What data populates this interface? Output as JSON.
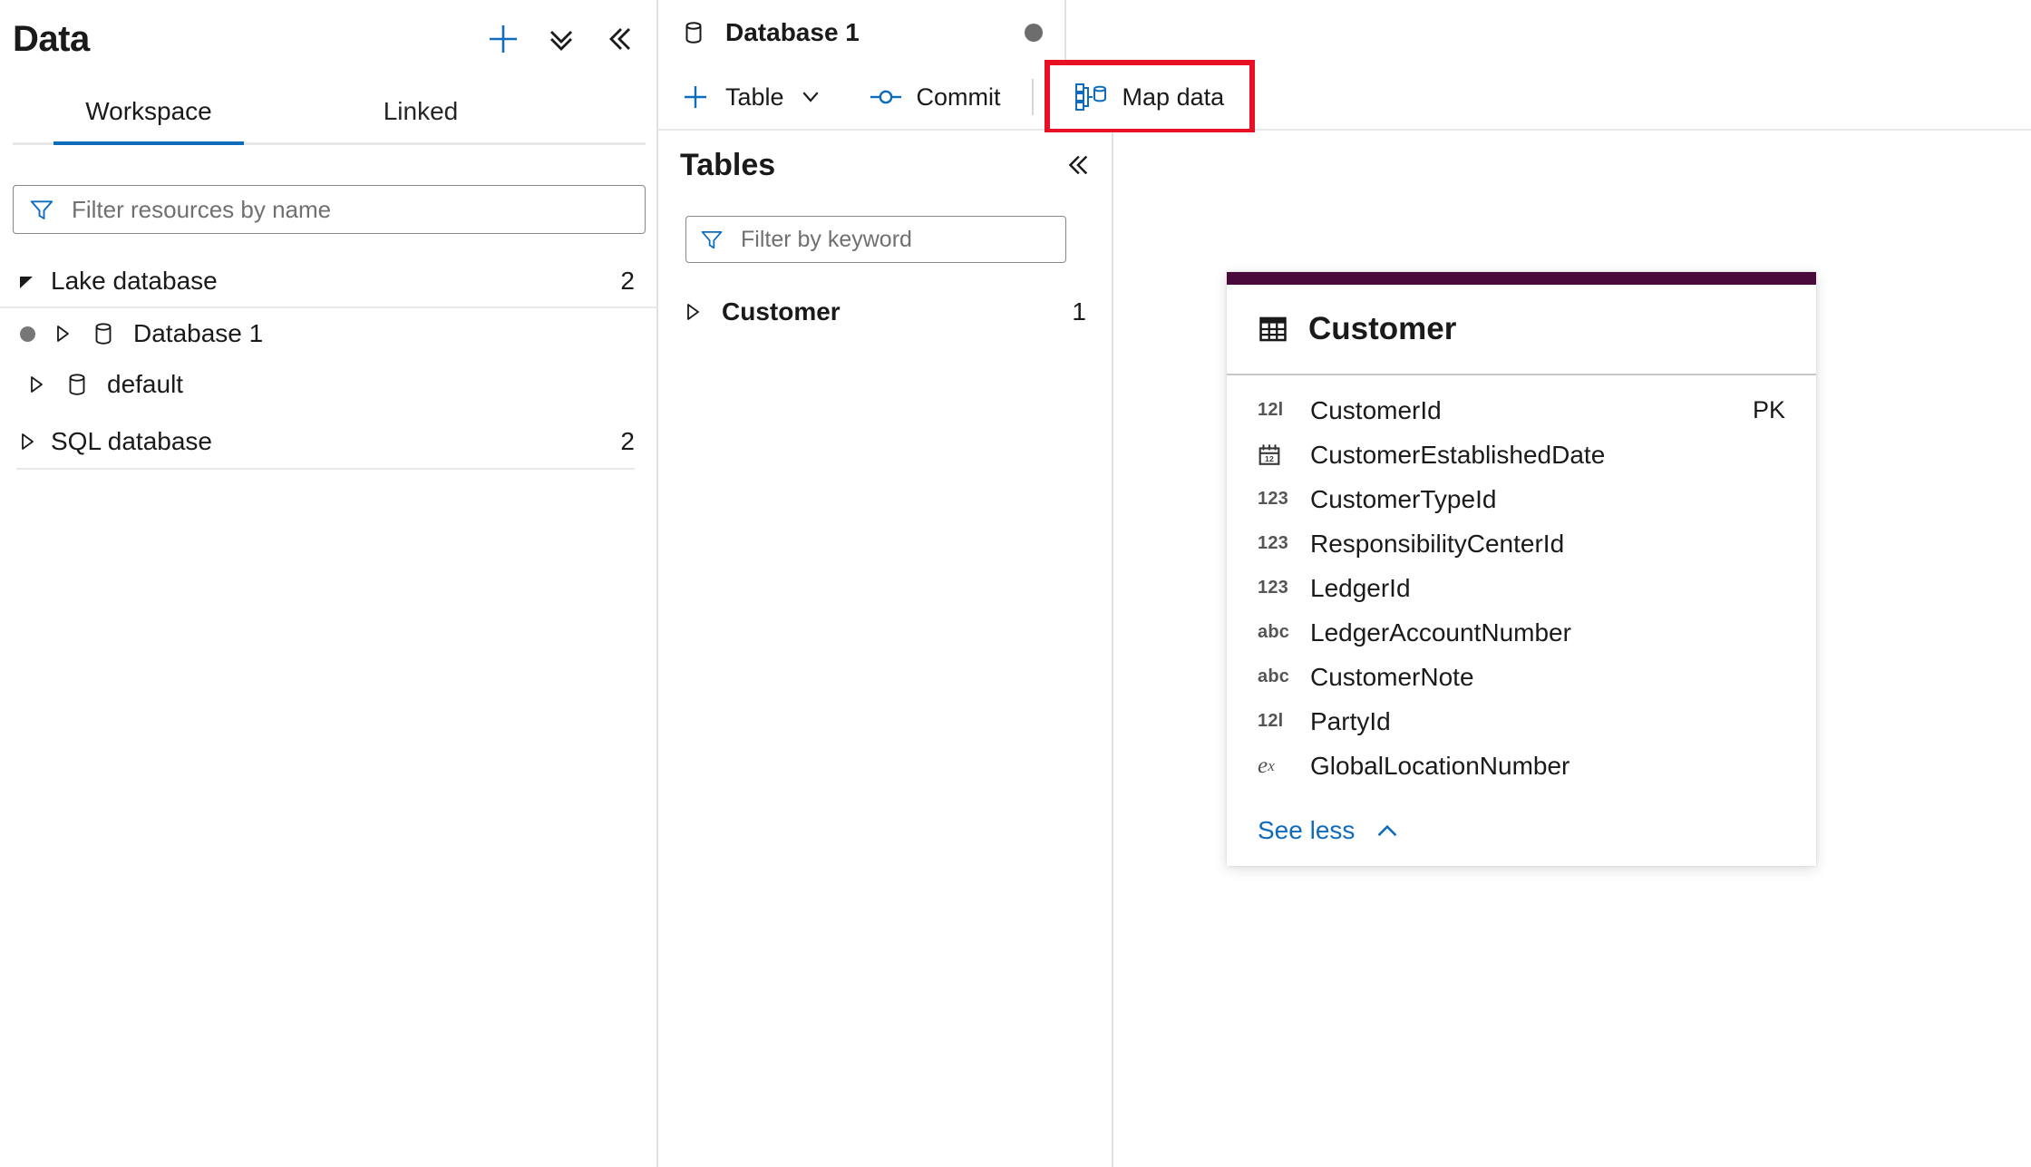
{
  "sidebar": {
    "title": "Data",
    "actions": [
      {
        "name": "add-button",
        "icon": "plus-icon",
        "label": "+"
      },
      {
        "name": "expand-all-button",
        "icon": "double-chevron-down-icon",
        "label": ""
      },
      {
        "name": "collapse-panel-button",
        "icon": "double-chevron-left-icon",
        "label": ""
      }
    ],
    "tabs": [
      {
        "label": "Workspace",
        "active": true
      },
      {
        "label": "Linked",
        "active": false
      }
    ],
    "filter": {
      "placeholder": "Filter resources by name",
      "value": "",
      "icon": "filter-icon"
    },
    "tree": [
      {
        "label": "Lake database",
        "count": "2",
        "expanded": true,
        "icon": "triangle-down-icon"
      },
      {
        "label": "Database 1",
        "count": "",
        "expanded": false,
        "icon": "database-icon",
        "status_dot": true
      },
      {
        "label": "default",
        "count": "",
        "expanded": false,
        "icon": "database-icon",
        "status_dot": false
      },
      {
        "label": "SQL database",
        "count": "2",
        "expanded": false,
        "icon": "triangle-right-icon"
      }
    ]
  },
  "document_tab": {
    "label": "Database 1",
    "icon": "database-icon",
    "unsaved_dot": true
  },
  "command_bar": {
    "buttons": [
      {
        "label": "Table",
        "icon": "plus-icon",
        "chevron": "chevron-down-icon",
        "highlighted": false
      },
      {
        "label": "Commit",
        "icon": "commit-icon",
        "chevron": "",
        "highlighted": false
      },
      {
        "label": "Map data",
        "icon": "map-data-icon",
        "chevron": "",
        "highlighted": true
      }
    ],
    "highlight_color": "#e81123"
  },
  "tables_panel": {
    "title": "Tables",
    "collapse_icon": "double-chevron-left-icon",
    "filter": {
      "placeholder": "Filter by keyword",
      "value": "",
      "icon": "filter-icon"
    },
    "items": [
      {
        "label": "Customer",
        "count": "1",
        "icon": "triangle-right-icon"
      }
    ]
  },
  "entity_card": {
    "accent_color": "#4A0A3C",
    "icon": "table-icon",
    "title": "Customer",
    "key_label_pk": "PK",
    "columns": [
      {
        "type_icon": "12l",
        "type": "long",
        "name": "CustomerId",
        "key": "PK"
      },
      {
        "type_icon": "cal",
        "type": "date",
        "name": "CustomerEstablishedDate",
        "key": ""
      },
      {
        "type_icon": "123",
        "type": "integer",
        "name": "CustomerTypeId",
        "key": ""
      },
      {
        "type_icon": "123",
        "type": "integer",
        "name": "ResponsibilityCenterId",
        "key": ""
      },
      {
        "type_icon": "123",
        "type": "integer",
        "name": "LedgerId",
        "key": ""
      },
      {
        "type_icon": "abc",
        "type": "string",
        "name": "LedgerAccountNumber",
        "key": ""
      },
      {
        "type_icon": "abc",
        "type": "string",
        "name": "CustomerNote",
        "key": ""
      },
      {
        "type_icon": "12l",
        "type": "long",
        "name": "PartyId",
        "key": ""
      },
      {
        "type_icon": "ex",
        "type": "decimal",
        "name": "GlobalLocationNumber",
        "key": ""
      }
    ],
    "see_less": {
      "label": "See less",
      "icon": "chevron-up-icon",
      "color": "#0f6cbd"
    }
  },
  "colors": {
    "accent_blue": "#0f6cbd",
    "highlight_red": "#e81123",
    "entity_purple": "#4A0A3C",
    "text": "#1a1a1a",
    "muted": "#707070"
  }
}
